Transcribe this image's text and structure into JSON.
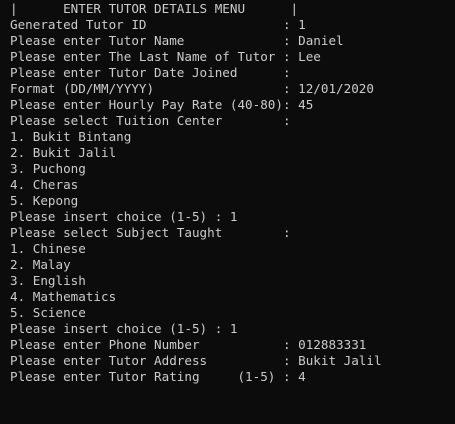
{
  "console": {
    "lines": [
      "|      ENTER TUTOR DETAILS MENU      |",
      "Generated Tutor ID                  : 1",
      "Please enter Tutor Name             : Daniel",
      "Please enter The Last Name of Tutor : Lee",
      "Please enter Tutor Date Joined      :",
      "Format (DD/MM/YYYY)                 : 12/01/2020",
      "Please enter Hourly Pay Rate (40-80): 45",
      "Please select Tuition Center        :",
      "1. Bukit Bintang",
      "2. Bukit Jalil",
      "3. Puchong",
      "4. Cheras",
      "5. Kepong",
      "Please insert choice (1-5) : 1",
      "Please select Subject Taught        :",
      "1. Chinese",
      "2. Malay",
      "3. English",
      "4. Mathematics",
      "5. Science",
      "Please insert choice (1-5) : 1",
      "Please enter Phone Number           : 012883331",
      "Please enter Tutor Address          : Bukit Jalil",
      "Please enter Tutor Rating     (1-5) : 4"
    ]
  },
  "colors": {
    "background": "#0c0c0c",
    "text": "#cccccc"
  }
}
